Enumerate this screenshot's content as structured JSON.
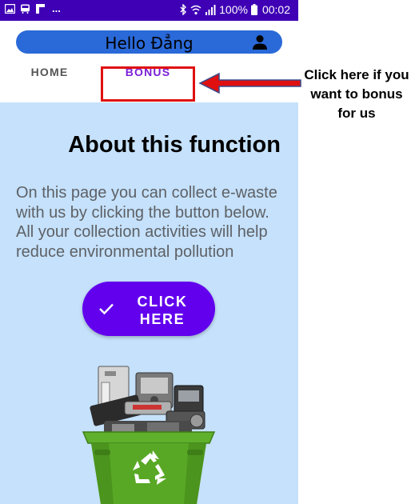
{
  "status_bar": {
    "left_dots": "...",
    "battery": "100%",
    "time": "00:02"
  },
  "app_bar": {
    "title": "Hello Đẳng",
    "icon": "user-icon"
  },
  "tabs": [
    {
      "label": "HOME",
      "selected": false
    },
    {
      "label": "BONUS",
      "selected": true
    }
  ],
  "content": {
    "heading": "About this function",
    "description": "On this page you can collect e-waste with us by clicking the button below. All your collection activities will help reduce environmental pollution",
    "button": {
      "label_line1": "CLICK",
      "label_line2": "HERE",
      "icon": "check-icon"
    }
  },
  "annotation": {
    "text": "Click here if you want to bonus for us"
  },
  "colors": {
    "status_bar": "#3f00b5",
    "app_bar": "#2a69d8",
    "selected_tab": "#7b1fd6",
    "content_bg": "#c5e1fb",
    "button": "#6200ee",
    "highlight": "#e01010"
  }
}
